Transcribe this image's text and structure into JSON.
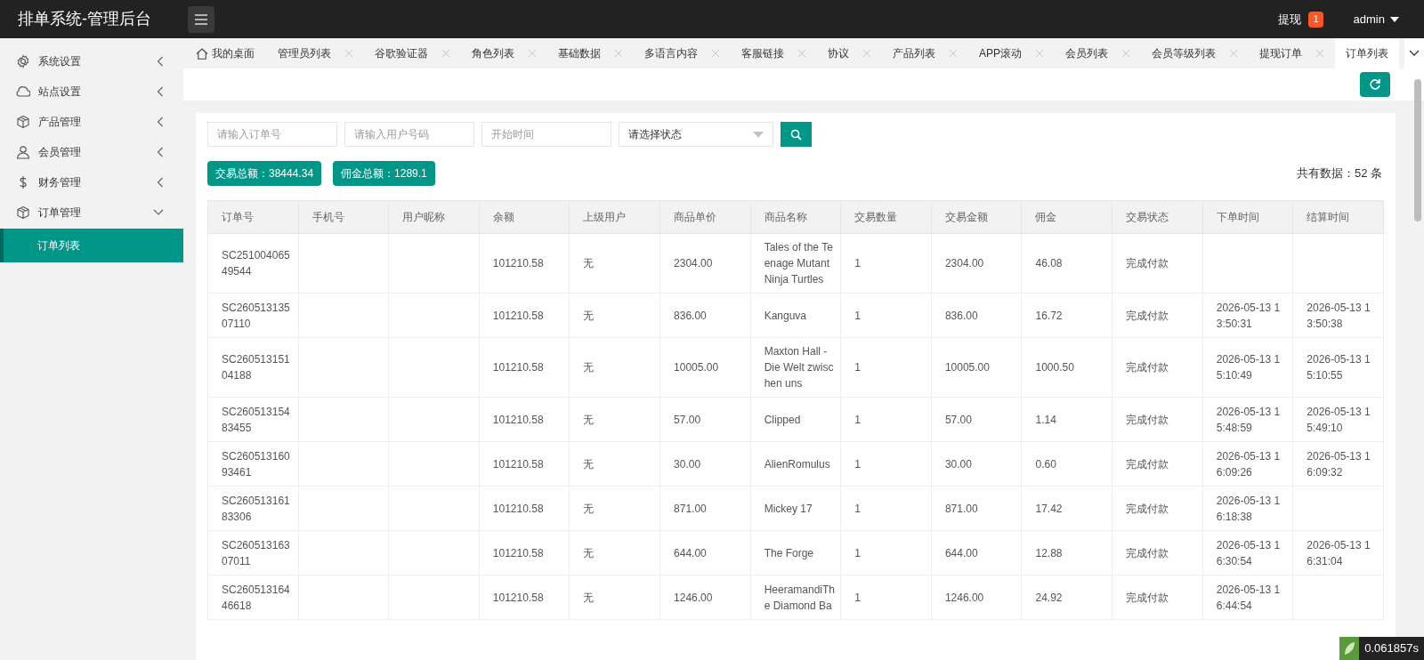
{
  "header": {
    "title": "排单系统-管理后台",
    "notice": {
      "label": "提现",
      "badge": "1"
    },
    "user": "admin"
  },
  "sidebar": {
    "items": [
      {
        "label": "系统设置",
        "kind": "gear",
        "expanded": false
      },
      {
        "label": "站点设置",
        "kind": "cloud",
        "expanded": false
      },
      {
        "label": "产品管理",
        "kind": "box",
        "expanded": false
      },
      {
        "label": "会员管理",
        "kind": "user",
        "expanded": false
      },
      {
        "label": "财务管理",
        "kind": "dollar",
        "expanded": false
      },
      {
        "label": "订单管理",
        "kind": "box",
        "expanded": true,
        "children": [
          {
            "label": "订单列表",
            "selected": true
          }
        ]
      }
    ]
  },
  "tabs": [
    {
      "label": "我的桌面",
      "kind": "home",
      "selected": false
    },
    {
      "label": "管理员列表",
      "kind": "closable",
      "selected": false
    },
    {
      "label": "谷歌验证器",
      "kind": "closable",
      "selected": false
    },
    {
      "label": "角色列表",
      "kind": "closable",
      "selected": false
    },
    {
      "label": "基础数据",
      "kind": "closable",
      "selected": false
    },
    {
      "label": "多语言内容",
      "kind": "closable",
      "selected": false
    },
    {
      "label": "客服链接",
      "kind": "closable",
      "selected": false
    },
    {
      "label": "协议",
      "kind": "closable",
      "selected": false
    },
    {
      "label": "产品列表",
      "kind": "closable",
      "selected": false
    },
    {
      "label": "APP滚动",
      "kind": "closable",
      "selected": false
    },
    {
      "label": "会员列表",
      "kind": "closable",
      "selected": false
    },
    {
      "label": "会员等级列表",
      "kind": "closable",
      "selected": false
    },
    {
      "label": "提现订单",
      "kind": "closable",
      "selected": false
    },
    {
      "label": "订单列表",
      "kind": "closable",
      "selected": true
    }
  ],
  "filters": {
    "order_no": {
      "placeholder": "请输入订单号"
    },
    "user_phone": {
      "placeholder": "请输入用户号码"
    },
    "start_time": {
      "placeholder": "开始时间"
    },
    "status": {
      "placeholder": "请选择状态"
    }
  },
  "summary": [
    "交易总额：38444.34",
    "佣金总额：1289.1"
  ],
  "total": "共有数据：52 条",
  "table": {
    "columns": [
      "订单号",
      "手机号",
      "用户昵称",
      "余额",
      "上级用户",
      "商品单价",
      "商品名称",
      "交易数量",
      "交易金额",
      "佣金",
      "交易状态",
      "下单时间",
      "结算时间"
    ],
    "rows": [
      [
        "SC25100406549544",
        "",
        "",
        "101210.58",
        "无",
        "2304.00",
        "Tales of the Teenage Mutant Ninja Turtles",
        "1",
        "2304.00",
        "46.08",
        "完成付款",
        "",
        ""
      ],
      [
        "SC26051313507110",
        "",
        "",
        "101210.58",
        "无",
        "836.00",
        "Kanguva",
        "1",
        "836.00",
        "16.72",
        "完成付款",
        "2026-05-13 13:50:31",
        "2026-05-13 13:50:38"
      ],
      [
        "SC26051315104188",
        "",
        "",
        "101210.58",
        "无",
        "10005.00",
        "Maxton Hall - Die Welt zwischen uns",
        "1",
        "10005.00",
        "1000.50",
        "完成付款",
        "2026-05-13 15:10:49",
        "2026-05-13 15:10:55"
      ],
      [
        "SC26051315483455",
        "",
        "",
        "101210.58",
        "无",
        "57.00",
        "Clipped",
        "1",
        "57.00",
        "1.14",
        "完成付款",
        "2026-05-13 15:48:59",
        "2026-05-13 15:49:10"
      ],
      [
        "SC26051316093461",
        "",
        "",
        "101210.58",
        "无",
        "30.00",
        "AlienRomulus",
        "1",
        "30.00",
        "0.60",
        "完成付款",
        "2026-05-13 16:09:26",
        "2026-05-13 16:09:32"
      ],
      [
        "SC26051316183306",
        "",
        "",
        "101210.58",
        "无",
        "871.00",
        "Mickey 17",
        "1",
        "871.00",
        "17.42",
        "完成付款",
        "2026-05-13 16:18:38",
        ""
      ],
      [
        "SC26051316307011",
        "",
        "",
        "101210.58",
        "无",
        "644.00",
        "The Forge",
        "1",
        "644.00",
        "12.88",
        "完成付款",
        "2026-05-13 16:30:54",
        "2026-05-13 16:31:04"
      ],
      [
        "SC26051316446618",
        "",
        "",
        "101210.58",
        "无",
        "1246.00",
        "HeeramandiThe Diamond Ba",
        "1",
        "1246.00",
        "24.92",
        "完成付款",
        "2026-05-13 16:44:54",
        ""
      ]
    ]
  },
  "debug_badge": "0.061857s"
}
